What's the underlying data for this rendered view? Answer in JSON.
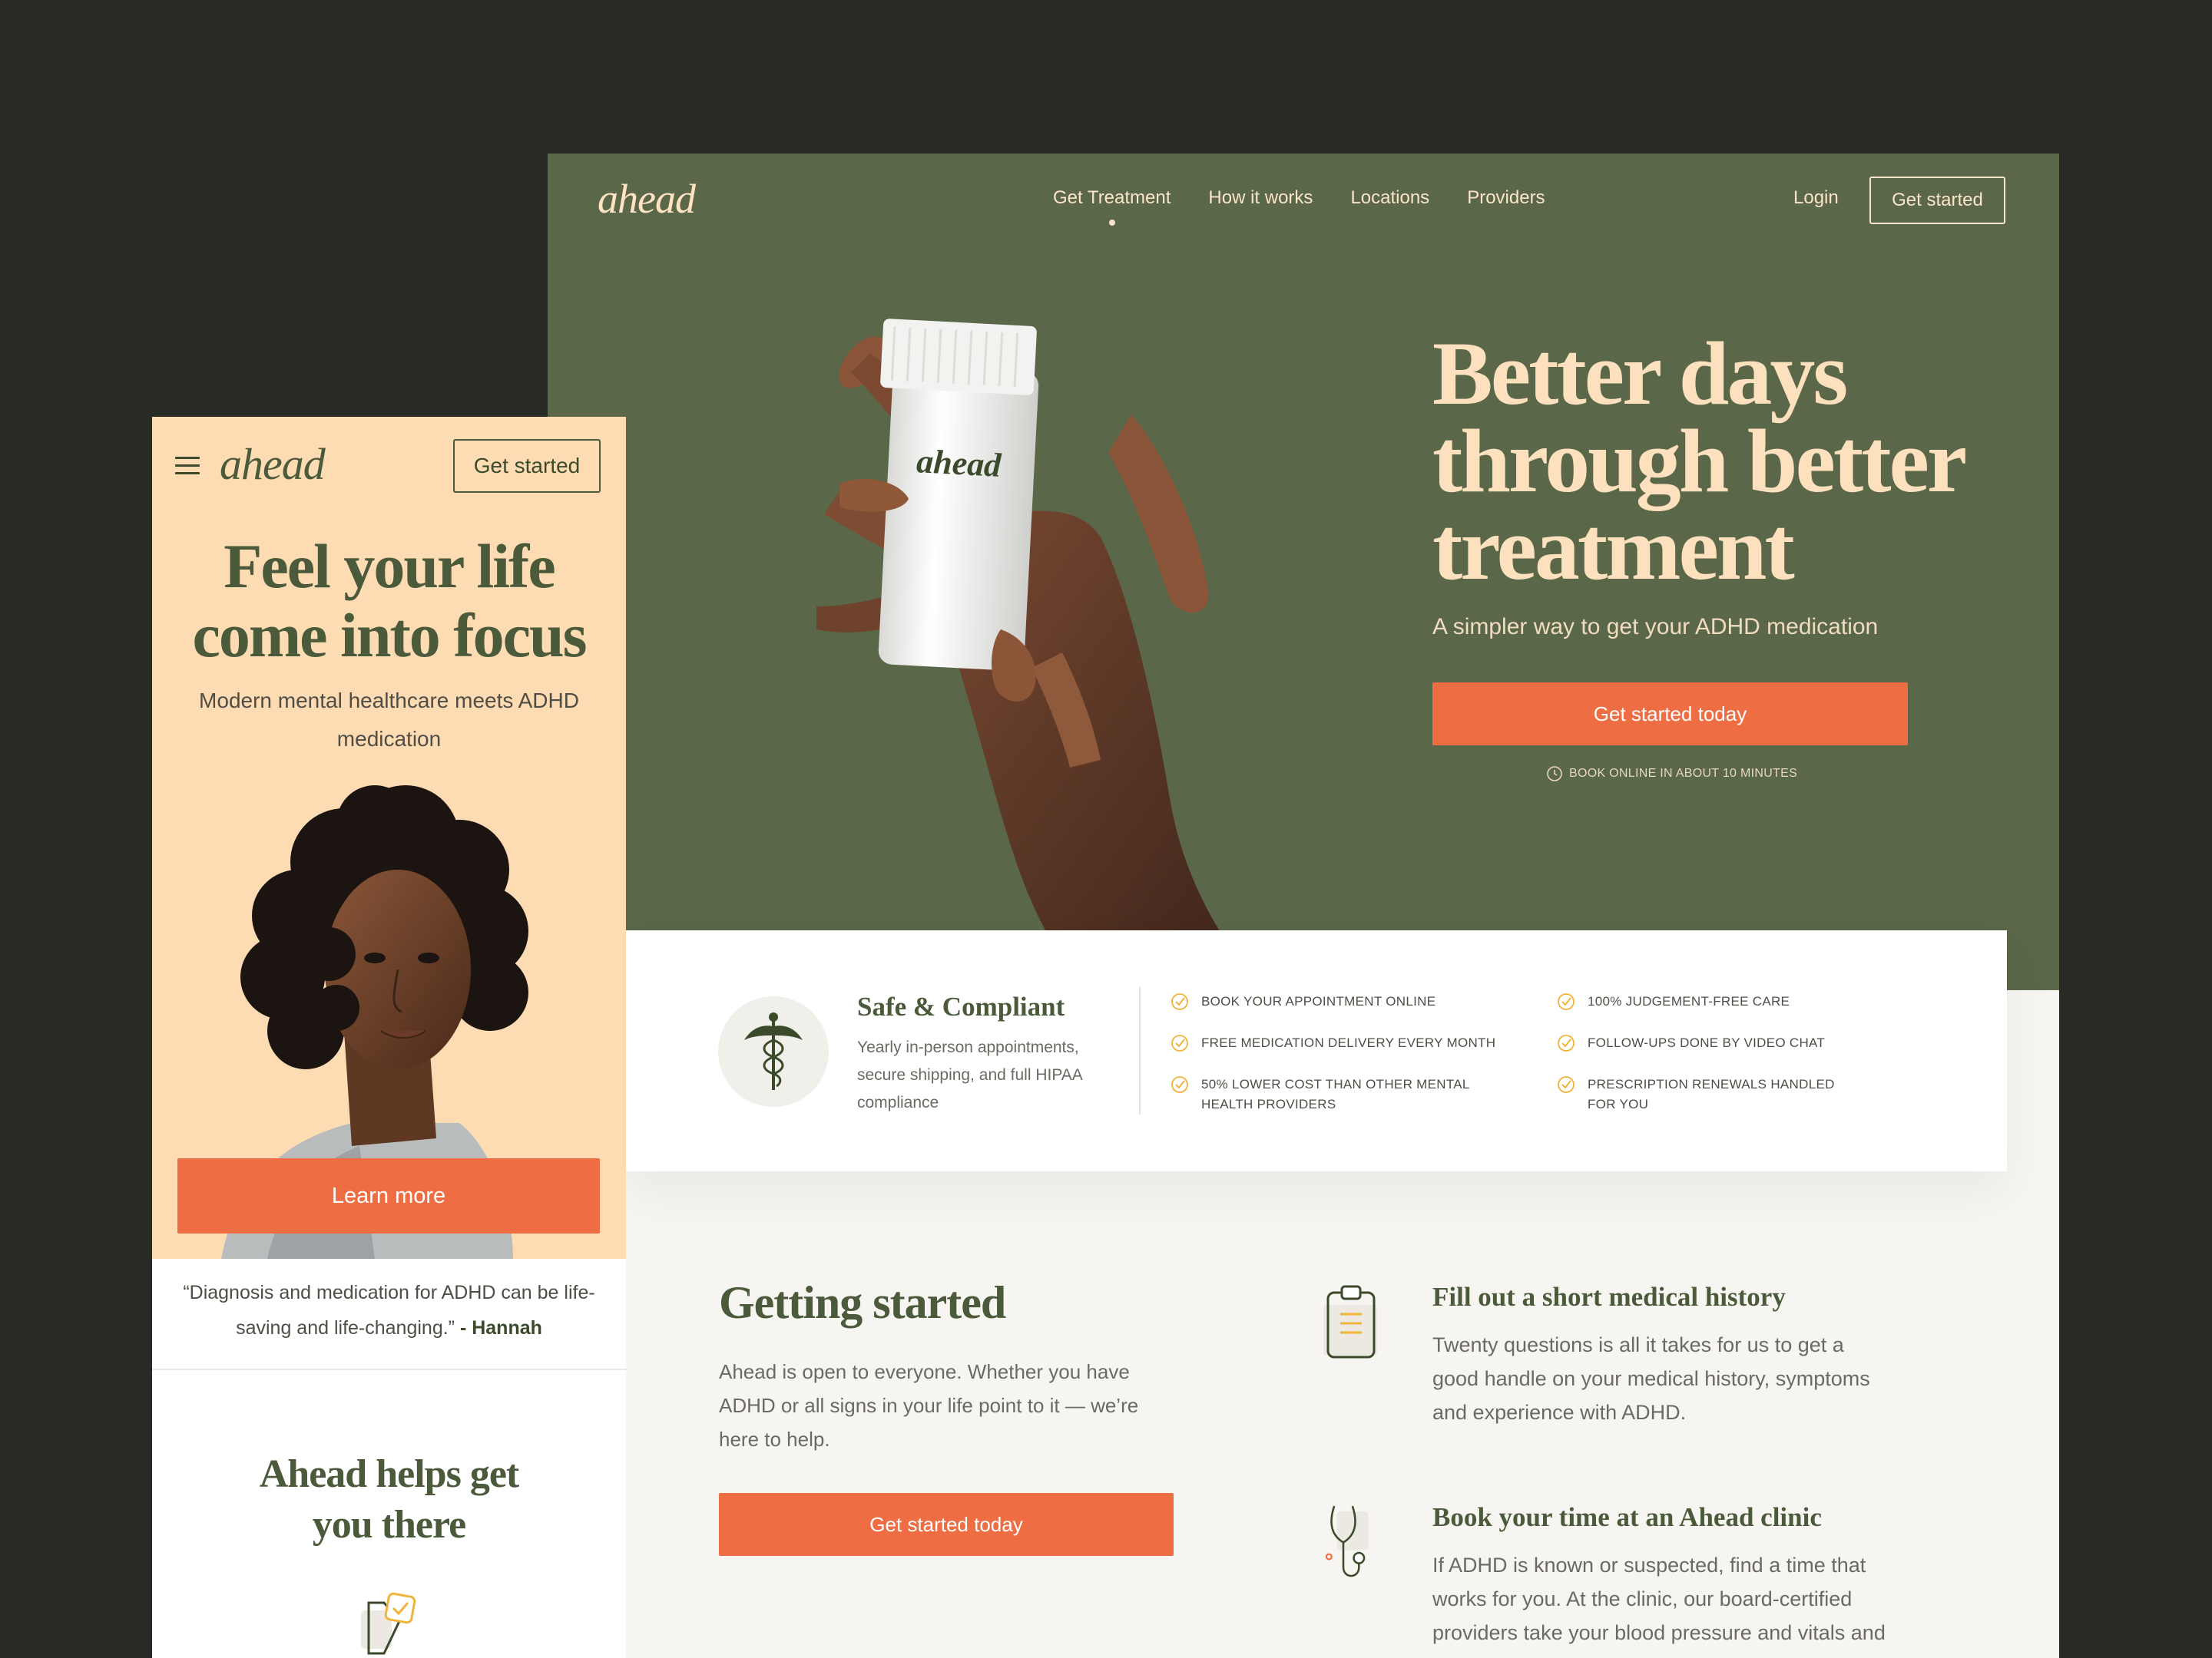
{
  "desktop": {
    "logo": "ahead",
    "nav": [
      "Get Treatment",
      "How it works",
      "Locations",
      "Providers"
    ],
    "login": "Login",
    "get_started": "Get started",
    "hero": {
      "title_lines": [
        "Better days",
        "through better",
        "treatment"
      ],
      "subtitle": "A simpler way to get your ADHD medication",
      "cta": "Get started today",
      "note": "BOOK ONLINE IN ABOUT 10 MINUTES",
      "bottle_label": "ahead"
    },
    "features": {
      "title": "Safe & Compliant",
      "desc": "Yearly in-person appointments, secure shipping, and full HIPAA compliance",
      "col1": [
        "BOOK YOUR APPOINTMENT ONLINE",
        "FREE MEDICATION DELIVERY EVERY MONTH",
        "50% LOWER COST THAN OTHER MENTAL HEALTH PROVIDERS"
      ],
      "col2": [
        "100% JUDGEMENT-FREE CARE",
        "FOLLOW-UPS DONE BY VIDEO CHAT",
        "PRESCRIPTION RENEWALS HANDLED FOR YOU"
      ]
    },
    "getting_started": {
      "title": "Getting started",
      "text": "Ahead is open to everyone. Whether you have ADHD or all signs in your life point to it — we’re here to help.",
      "cta": "Get started today"
    },
    "steps": [
      {
        "title": "Fill out a short medical history",
        "text": "Twenty questions is all it takes for us to get a good handle on your medical history, symptoms and experience with ADHD.",
        "icon": "clipboard-icon"
      },
      {
        "title": "Book your time at an Ahead clinic",
        "text": "If ADHD is known or suspected, find a time that works for you. At the clinic, our board-certified providers take your blood pressure and vitals and",
        "icon": "stethoscope-icon"
      }
    ]
  },
  "mobile": {
    "logo": "ahead",
    "get_started": "Get started",
    "title_lines": [
      "Feel your life",
      "come into focus"
    ],
    "subtitle": "Modern mental healthcare meets ADHD medication",
    "cta": "Learn more",
    "quote": "“Diagnosis and medication for ADHD can be life-saving and life-changing.”",
    "quote_author": "- Hannah",
    "helps_title": "Ahead helps get you there"
  },
  "colors": {
    "green": "#5a6849",
    "cream": "#fde0bd",
    "peach": "#fedcb3",
    "orange": "#ef6d43",
    "dark_bg": "#282a25"
  }
}
